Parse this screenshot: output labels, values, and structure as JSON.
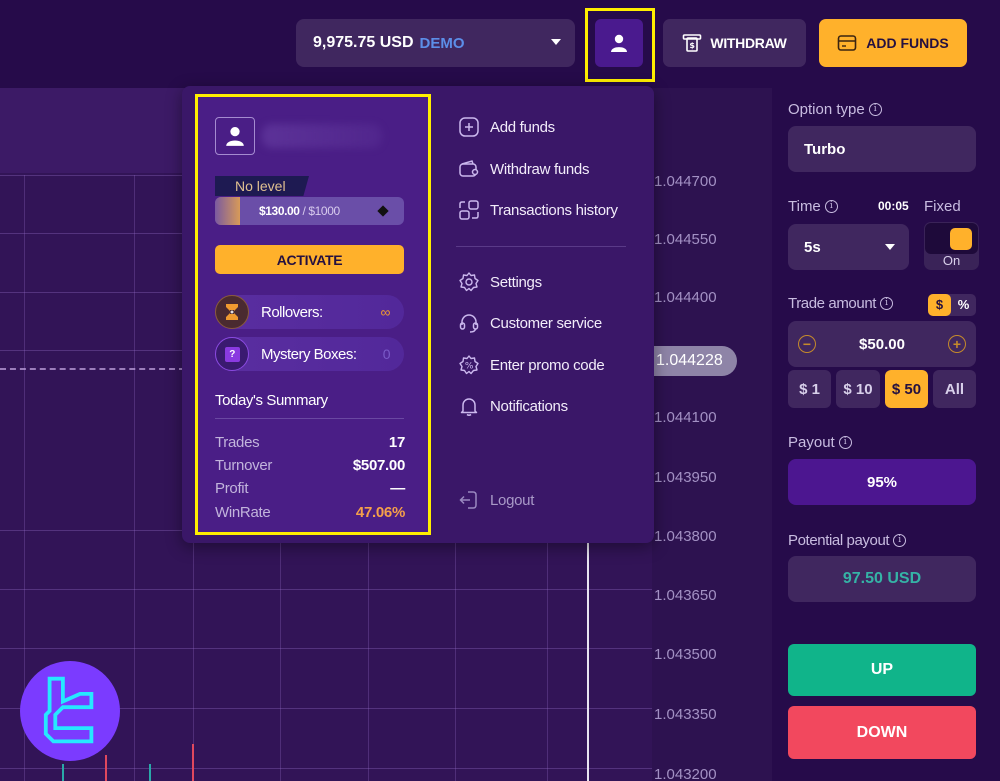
{
  "header": {
    "balance": "9,975.75 USD",
    "account_type": "DEMO",
    "withdraw_label": "WITHDRAW",
    "add_funds_label": "ADD FUNDS"
  },
  "profile_menu": {
    "level_label": "No level",
    "level_progress_current": "$130.00",
    "level_progress_target": " / $1000",
    "level_progress_fraction": 0.13,
    "activate_label": "ACTIVATE",
    "rollovers_label": "Rollovers:",
    "rollovers_value": "∞",
    "mystery_boxes_label": "Mystery Boxes:",
    "mystery_boxes_value": "0",
    "summary_title": "Today's Summary",
    "summary": [
      {
        "key": "Trades",
        "value": "17"
      },
      {
        "key": "Turnover",
        "value": "$507.00"
      },
      {
        "key": "Profit",
        "value": "—"
      },
      {
        "key": "WinRate",
        "value": "47.06%"
      }
    ],
    "menu_items": [
      {
        "label": "Add funds",
        "icon": "plus-square-icon"
      },
      {
        "label": "Withdraw funds",
        "icon": "wallet-icon"
      },
      {
        "label": "Transactions history",
        "icon": "transactions-icon"
      },
      {
        "label": "Settings",
        "icon": "gear-icon"
      },
      {
        "label": "Customer service",
        "icon": "headset-icon"
      },
      {
        "label": "Enter promo code",
        "icon": "promo-badge-icon"
      },
      {
        "label": "Notifications",
        "icon": "bell-icon"
      }
    ],
    "logout_label": "Logout"
  },
  "chart": {
    "price_ticks": [
      "1.044700",
      "1.044550",
      "1.044400",
      "1.044100",
      "1.043950",
      "1.043800",
      "1.043650",
      "1.043500",
      "1.043350",
      "1.043200"
    ],
    "current_price": "1.044228"
  },
  "trade_panel": {
    "option_type_label": "Option type",
    "option_type_value": "Turbo",
    "time_label": "Time",
    "time_countdown": "00:05",
    "fixed_label": "Fixed",
    "time_value": "5s",
    "fixed_toggle_state": "On",
    "trade_amount_label": "Trade amount",
    "unit_dollar": "$",
    "unit_percent": "%",
    "amount_value": "$50.00",
    "quick_amounts": [
      "$ 1",
      "$ 10",
      "$ 50",
      "All"
    ],
    "quick_amount_selected": "$ 50",
    "payout_label": "Payout",
    "payout_value": "95%",
    "potential_payout_label": "Potential payout",
    "potential_payout_value": "97.50 USD",
    "up_label": "UP",
    "down_label": "DOWN"
  },
  "colors": {
    "accent": "#ffb12b",
    "up": "#10b48a",
    "down": "#f2485e",
    "highlight": "#ffee00",
    "winrate": "#f5a04a",
    "potential_payout": "#35b3a6"
  }
}
